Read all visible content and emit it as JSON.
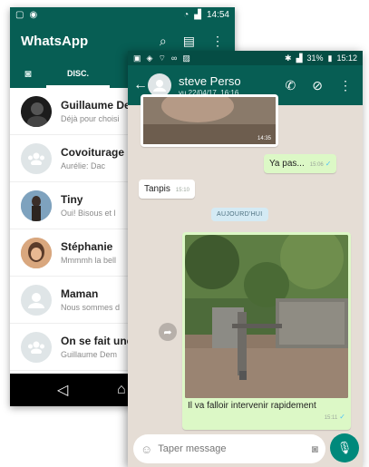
{
  "back": {
    "status_time": "14:54",
    "app_title": "WhatsApp",
    "tab_chats": "DISC.",
    "chats": [
      {
        "name": "Guillaume De",
        "msg": "Déjà pour choisi"
      },
      {
        "name": "Covoiturage n",
        "msg": "Aurélie: Dac"
      },
      {
        "name": "Tiny",
        "msg": "Oui! Bisous et l"
      },
      {
        "name": "Stéphanie",
        "msg": "Mmmmh la bell"
      },
      {
        "name": "Maman",
        "msg": "Nous sommes d"
      },
      {
        "name": "On se fait une",
        "msg": "Guillaume Dem"
      }
    ]
  },
  "front": {
    "status_battery": "31%",
    "status_time": "15:12",
    "contact_name": "steve Perso",
    "last_seen": "vu 22/04/17, 16:16",
    "messages": {
      "img_top_time": "14:35",
      "out1_text": "Ya pas...",
      "out1_time": "15:06",
      "in1_text": "Tanpis",
      "in1_time": "15:10",
      "date_chip": "AUJOURD'HUI",
      "img_caption": "Il va falloir intervenir rapidement",
      "img_time": "15:11"
    },
    "input_placeholder": "Taper message"
  },
  "colors": {
    "whatsapp_green": "#075e54",
    "outgoing_bubble": "#dcf8c6",
    "mic_button": "#00897b",
    "chat_bg": "#e5ddd5"
  }
}
